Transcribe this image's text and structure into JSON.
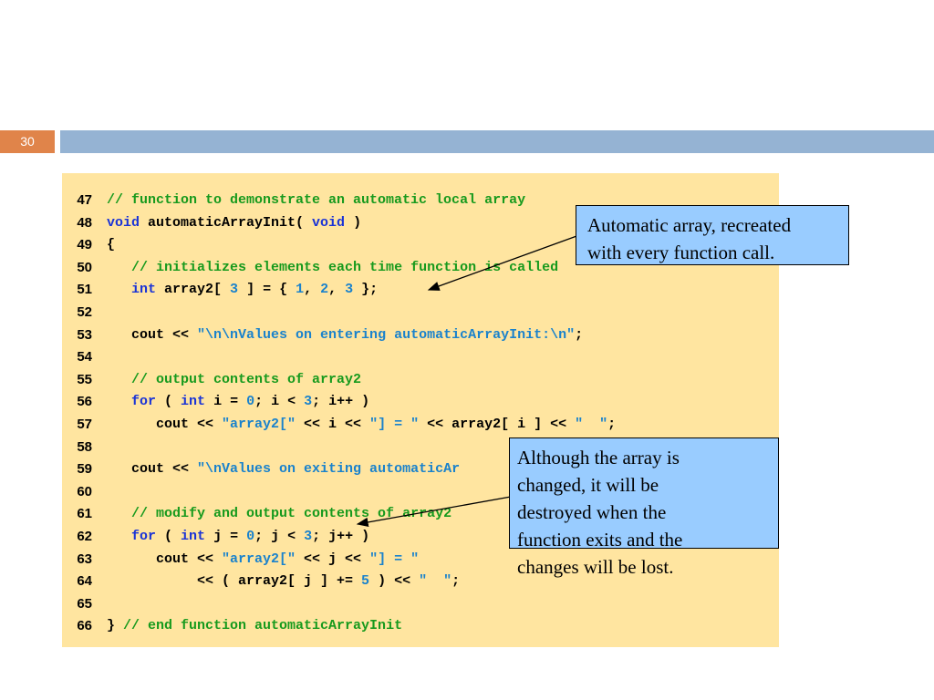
{
  "slide": {
    "number": "30"
  },
  "code_lines": [
    {
      "num": "47",
      "tokens": [
        {
          "t": "// function to demonstrate an automatic local array",
          "c": "cm"
        }
      ]
    },
    {
      "num": "48",
      "tokens": [
        {
          "t": "void",
          "c": "kw"
        },
        {
          "t": " automaticArrayInit( ",
          "c": ""
        },
        {
          "t": "void",
          "c": "kw"
        },
        {
          "t": " )",
          "c": ""
        }
      ]
    },
    {
      "num": "49",
      "tokens": [
        {
          "t": "{",
          "c": ""
        }
      ]
    },
    {
      "num": "50",
      "tokens": [
        {
          "t": "   ",
          "c": ""
        },
        {
          "t": "// initializes elements each time function is called",
          "c": "cm"
        }
      ]
    },
    {
      "num": "51",
      "tokens": [
        {
          "t": "   ",
          "c": ""
        },
        {
          "t": "int",
          "c": "kw"
        },
        {
          "t": " array2[ ",
          "c": ""
        },
        {
          "t": "3",
          "c": "nm"
        },
        {
          "t": " ] = { ",
          "c": ""
        },
        {
          "t": "1",
          "c": "nm"
        },
        {
          "t": ", ",
          "c": ""
        },
        {
          "t": "2",
          "c": "nm"
        },
        {
          "t": ", ",
          "c": ""
        },
        {
          "t": "3",
          "c": "nm"
        },
        {
          "t": " };",
          "c": ""
        }
      ]
    },
    {
      "num": "52",
      "tokens": []
    },
    {
      "num": "53",
      "tokens": [
        {
          "t": "   cout << ",
          "c": ""
        },
        {
          "t": "\"\\n\\nValues on entering automaticArrayInit:\\n\"",
          "c": "st"
        },
        {
          "t": ";",
          "c": ""
        }
      ]
    },
    {
      "num": "54",
      "tokens": []
    },
    {
      "num": "55",
      "tokens": [
        {
          "t": "   ",
          "c": ""
        },
        {
          "t": "// output contents of array2",
          "c": "cm"
        }
      ]
    },
    {
      "num": "56",
      "tokens": [
        {
          "t": "   ",
          "c": ""
        },
        {
          "t": "for",
          "c": "kw"
        },
        {
          "t": " ( ",
          "c": ""
        },
        {
          "t": "int",
          "c": "kw"
        },
        {
          "t": " i = ",
          "c": ""
        },
        {
          "t": "0",
          "c": "nm"
        },
        {
          "t": "; i < ",
          "c": ""
        },
        {
          "t": "3",
          "c": "nm"
        },
        {
          "t": "; i++ )",
          "c": ""
        }
      ]
    },
    {
      "num": "57",
      "tokens": [
        {
          "t": "      cout << ",
          "c": ""
        },
        {
          "t": "\"array2[\"",
          "c": "st"
        },
        {
          "t": " << i << ",
          "c": ""
        },
        {
          "t": "\"] = \"",
          "c": "st"
        },
        {
          "t": " << array2[ i ] << ",
          "c": ""
        },
        {
          "t": "\"  \"",
          "c": "st"
        },
        {
          "t": ";",
          "c": ""
        }
      ]
    },
    {
      "num": "58",
      "tokens": []
    },
    {
      "num": "59",
      "tokens": [
        {
          "t": "   cout << ",
          "c": ""
        },
        {
          "t": "\"\\nValues on exiting automaticAr",
          "c": "st"
        }
      ]
    },
    {
      "num": "60",
      "tokens": []
    },
    {
      "num": "61",
      "tokens": [
        {
          "t": "   ",
          "c": ""
        },
        {
          "t": "// modify and output contents of array2",
          "c": "cm"
        }
      ]
    },
    {
      "num": "62",
      "tokens": [
        {
          "t": "   ",
          "c": ""
        },
        {
          "t": "for",
          "c": "kw"
        },
        {
          "t": " ( ",
          "c": ""
        },
        {
          "t": "int",
          "c": "kw"
        },
        {
          "t": " j = ",
          "c": ""
        },
        {
          "t": "0",
          "c": "nm"
        },
        {
          "t": "; j < ",
          "c": ""
        },
        {
          "t": "3",
          "c": "nm"
        },
        {
          "t": "; j++ )",
          "c": ""
        }
      ]
    },
    {
      "num": "63",
      "tokens": [
        {
          "t": "      cout << ",
          "c": ""
        },
        {
          "t": "\"array2[\"",
          "c": "st"
        },
        {
          "t": " << j << ",
          "c": ""
        },
        {
          "t": "\"] = \"",
          "c": "st"
        }
      ]
    },
    {
      "num": "64",
      "tokens": [
        {
          "t": "           << ( array2[ j ] += ",
          "c": ""
        },
        {
          "t": "5",
          "c": "nm"
        },
        {
          "t": " ) << ",
          "c": ""
        },
        {
          "t": "\"  \"",
          "c": "st"
        },
        {
          "t": ";",
          "c": ""
        }
      ]
    },
    {
      "num": "65",
      "tokens": []
    },
    {
      "num": "66",
      "tokens": [
        {
          "t": "} ",
          "c": ""
        },
        {
          "t": "// end function automaticArrayInit",
          "c": "cm"
        }
      ]
    }
  ],
  "callouts": {
    "first": {
      "line1": "Automatic array, recreated",
      "line2": "with every function call."
    },
    "second": {
      "line1": "Although the array is",
      "line2": "changed, it will be",
      "line3": "destroyed when the",
      "line4": "function exits and the",
      "line5": "changes will be lost."
    }
  },
  "colors": {
    "slide_number_bg": "#e0844a",
    "title_bar_bg": "#95b3d3",
    "code_panel_bg": "#ffe5a0",
    "comment": "#179a1d",
    "keyword": "#1a33d6",
    "string": "#1a82cc",
    "callout_bg": "#99ccff"
  }
}
